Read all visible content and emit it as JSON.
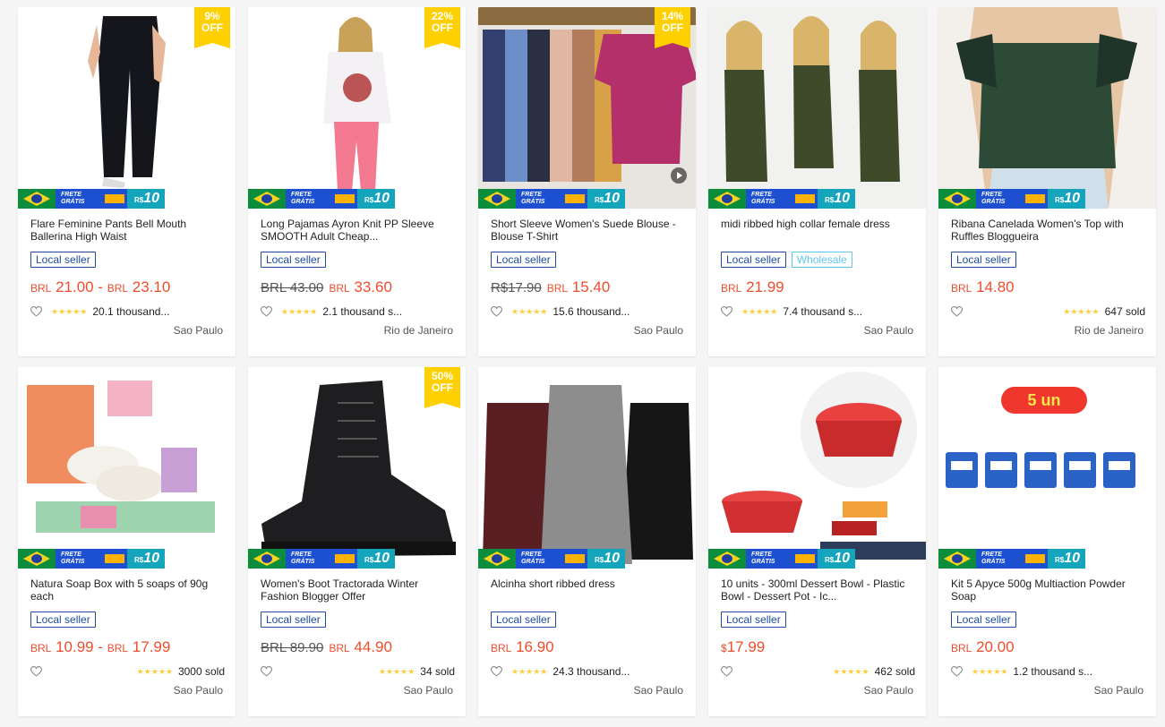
{
  "products": [
    {
      "title": "Flare Feminine Pants Bell Mouth Ballerina High Waist",
      "discount": "9%\nOFF",
      "badges": [
        "Local seller"
      ],
      "price_old": "",
      "price": "BRL 21.00 - BRL 23.10",
      "sold": "20.1 thousand...",
      "location": "Sao Paulo"
    },
    {
      "title": "Long Pajamas Ayron Knit PP Sleeve SMOOTH Adult Cheap...",
      "discount": "22%\nOFF",
      "badges": [
        "Local seller"
      ],
      "price_old": "BRL 43.00",
      "price": "BRL 33.60",
      "sold": "2.1 thousand s...",
      "location": "Rio de Janeiro"
    },
    {
      "title": "Short Sleeve Women's Suede Blouse - Blouse T-Shirt",
      "discount": "14%\nOFF",
      "badges": [
        "Local seller"
      ],
      "price_old": "R$17.90",
      "price": "BRL 15.40",
      "sold": "15.6 thousand...",
      "location": "Sao Paulo"
    },
    {
      "title": "midi ribbed high collar female dress",
      "discount": "",
      "badges": [
        "Local seller",
        "Wholesale"
      ],
      "price_old": "",
      "price": "BRL 21.99",
      "sold": "7.4 thousand s...",
      "location": "Sao Paulo"
    },
    {
      "title": "Ribana Canelada Women's Top with Ruffles Bloggueira",
      "discount": "",
      "badges": [
        "Local seller"
      ],
      "price_old": "",
      "price": "BRL 14.80",
      "sold": "647 sold",
      "location": "Rio de Janeiro"
    },
    {
      "title": "Natura Soap Box with 5 soaps of 90g each",
      "discount": "",
      "badges": [
        "Local seller"
      ],
      "price_old": "",
      "price": "BRL 10.99 - BRL 17.99",
      "sold": "3000 sold",
      "location": "Sao Paulo"
    },
    {
      "title": "Women's Boot Tractorada Winter Fashion Blogger Offer",
      "discount": "50%\nOFF",
      "badges": [
        "Local seller"
      ],
      "price_old": "BRL 89.90",
      "price": "BRL 44.90",
      "sold": "34 sold",
      "location": "Sao Paulo"
    },
    {
      "title": "Alcinha short ribbed dress",
      "discount": "",
      "badges": [
        "Local seller"
      ],
      "price_old": "",
      "price": "BRL 16.90",
      "sold": "24.3 thousand...",
      "location": "Sao Paulo"
    },
    {
      "title": "10 units - 300ml Dessert Bowl - Plastic Bowl - Dessert Pot - Ic...",
      "discount": "",
      "badges": [
        "Local seller"
      ],
      "price_old": "",
      "price": "$17.99",
      "sold": "462 sold",
      "location": "Sao Paulo"
    },
    {
      "title": "Kit 5 Apyce 500g Multiaction Powder Soap",
      "discount": "",
      "badges": [
        "Local seller"
      ],
      "price_old": "",
      "price": "BRL 20.00",
      "sold": "1.2 thousand s...",
      "location": "Sao Paulo"
    }
  ],
  "promo": {
    "frete": "FRETE GRÁTIS",
    "off": "10",
    "off_label": "CUPOM DE R$"
  },
  "stars": "★★★★★",
  "five_un": "5 un",
  "colors": {
    "price": "#ee4d2d",
    "badge": "#1d4a9e",
    "wholesale": "#5fc5f0",
    "discount": "#ffd000",
    "star": "#ffce3d"
  }
}
